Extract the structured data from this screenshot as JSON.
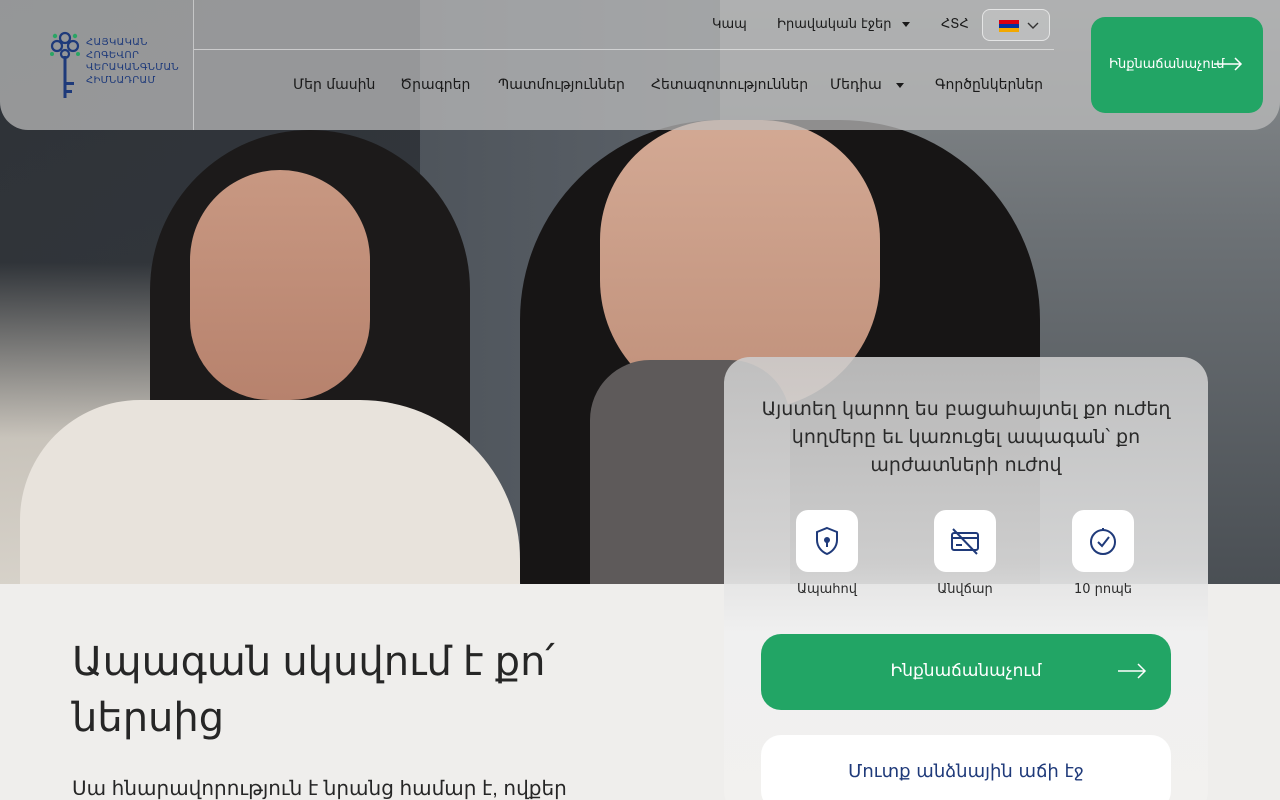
{
  "header": {
    "logo": {
      "lines": [
        "ՀԱՅԿԱԿԱՆ",
        "ՀՈԳԵՎՈՐ",
        "ՎԵՐԱԿԱՆԳՆՄԱՆ",
        "ՀԻՄՆԱԴՐԱՄ"
      ],
      "icon": "key-tree-logo"
    },
    "top_links": [
      {
        "label": "Կապ"
      },
      {
        "label": "Իրավական էջեր",
        "has_dropdown": true
      },
      {
        "label": "ՀՏՀ"
      }
    ],
    "language": {
      "selected": "hy",
      "icon": "armenia-flag-icon",
      "colors": [
        "#d90012",
        "#0033a0",
        "#f2a800"
      ]
    },
    "nav": [
      {
        "label": "Մեր մասին"
      },
      {
        "label": "Ծրագրեր"
      },
      {
        "label": "Պատմություններ"
      },
      {
        "label": "Հետազոտություններ"
      },
      {
        "label": "Մեդիա",
        "has_dropdown": true
      },
      {
        "label": "Գործընկերներ"
      }
    ],
    "cta": {
      "label": "Ինքնաճանաչում",
      "icon": "arrow-right-icon"
    }
  },
  "hero": {
    "headline": "Ապագան սկսվում է քո՛ ներսից",
    "subtext": "Սա հնարավորություն է նրանց համար է, ովքեր"
  },
  "card": {
    "text": "Այստեղ կարող ես բացահայտել քո ուժեղ կողմերը եւ կառուցել ապագան՝ քո արժատների ուժով",
    "features": [
      {
        "label": "Ապահով",
        "icon": "shield-lock-icon"
      },
      {
        "label": "Անվճար",
        "icon": "no-payment-card-icon"
      },
      {
        "label": "10 րոպե",
        "icon": "clock-check-icon"
      }
    ],
    "cta": {
      "label": "Ինքնաճանաչում",
      "icon": "arrow-right-icon"
    },
    "login": {
      "label": "Մուտք անձնային աճի էջ"
    }
  },
  "colors": {
    "accent": "#22a565",
    "brand_blue": "#1f3a7a"
  }
}
